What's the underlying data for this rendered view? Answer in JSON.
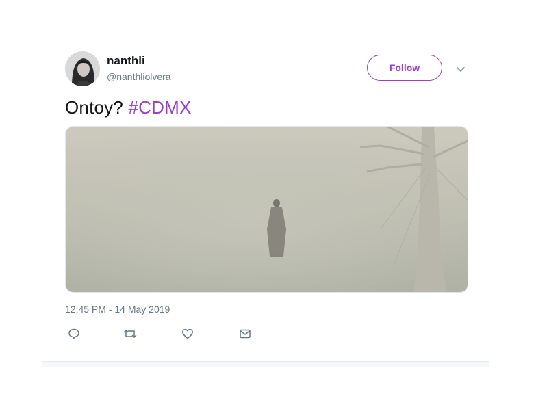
{
  "author": {
    "display_name": "nanthli",
    "handle": "@nanthliolvera"
  },
  "follow_button": {
    "label": "Follow"
  },
  "tweet": {
    "text": "Ontoy?",
    "hashtag": "#CDMX"
  },
  "media": {
    "description_icon": "photo"
  },
  "timestamp": "12:45 PM - 14 May 2019",
  "actions": {
    "reply_icon": "reply-icon",
    "retweet_icon": "retweet-icon",
    "like_icon": "heart-icon",
    "dm_icon": "envelope-icon"
  },
  "colors": {
    "accent": "#9b3ccf",
    "text": "#14171a",
    "secondary": "#657786"
  }
}
